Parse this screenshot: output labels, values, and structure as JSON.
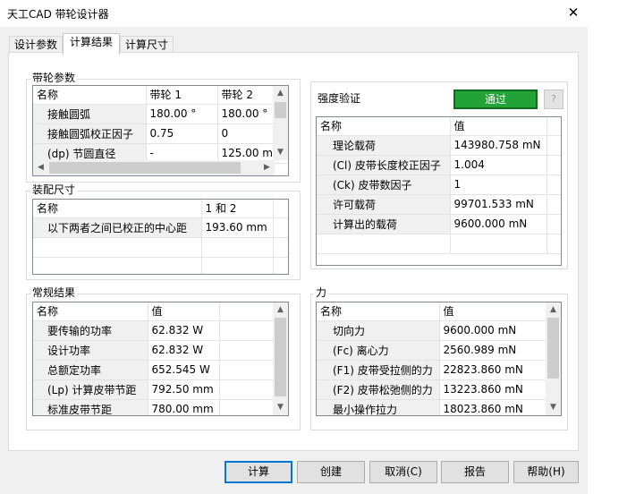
{
  "window": {
    "title": "天工CAD 带轮设计器",
    "close_glyph": "✕"
  },
  "tabs": [
    {
      "label": "设计参数"
    },
    {
      "label": "计算结果"
    },
    {
      "label": "计算尺寸"
    }
  ],
  "belt_params": {
    "title": "带轮参数",
    "headers": [
      "名称",
      "带轮 1",
      "带轮 2"
    ],
    "rows": [
      [
        "接触圆弧",
        "180.00 °",
        "180.00 °"
      ],
      [
        "接触圆弧校正因子",
        "0.75",
        "0"
      ],
      [
        "(dp) 节圆直径",
        "-",
        "125.00 mm"
      ]
    ]
  },
  "assembly": {
    "title": "装配尺寸",
    "headers": [
      "名称",
      "1 和 2"
    ],
    "rows": [
      [
        "以下两者之间已校正的中心距",
        "193.60 mm"
      ]
    ]
  },
  "general": {
    "title": "常规结果",
    "headers": [
      "名称",
      "值"
    ],
    "rows": [
      [
        "要传输的功率",
        "62.832 W"
      ],
      [
        "设计功率",
        "62.832 W"
      ],
      [
        "总额定功率",
        "652.545 W"
      ],
      [
        "(Lp) 计算皮带节距",
        "792.50 mm"
      ],
      [
        "标准皮带节距",
        "780.00 mm"
      ]
    ]
  },
  "strength": {
    "title": "强度验证",
    "status": "通过",
    "status_color": "#23a237",
    "help": "?",
    "headers": [
      "名称",
      "值"
    ],
    "rows": [
      [
        "理论载荷",
        "143980.758 mN"
      ],
      [
        "(Cl) 皮带长度校正因子",
        "1.004"
      ],
      [
        "(Ck) 皮带数因子",
        "1"
      ],
      [
        "许可载荷",
        "99701.533 mN"
      ],
      [
        "计算出的载荷",
        "9600.000 mN"
      ]
    ]
  },
  "force": {
    "title": "力",
    "headers": [
      "名称",
      "值"
    ],
    "rows": [
      [
        "切向力",
        "9600.000 mN"
      ],
      [
        "(Fc) 离心力",
        "2560.989 mN"
      ],
      [
        "(F1) 皮带受拉侧的力",
        "22823.860 mN"
      ],
      [
        "(F2) 皮带松弛侧的力",
        "13223.860 mN"
      ],
      [
        "最小操作拉力",
        "18023.860 mN"
      ]
    ]
  },
  "buttons": {
    "calculate": "计算",
    "create": "创建",
    "cancel": "取消(C)",
    "report": "报告",
    "help": "帮助(H)"
  },
  "icons": {
    "scroll_up": "▲",
    "scroll_down": "▼",
    "scroll_left": "◀",
    "scroll_right": "▶"
  }
}
